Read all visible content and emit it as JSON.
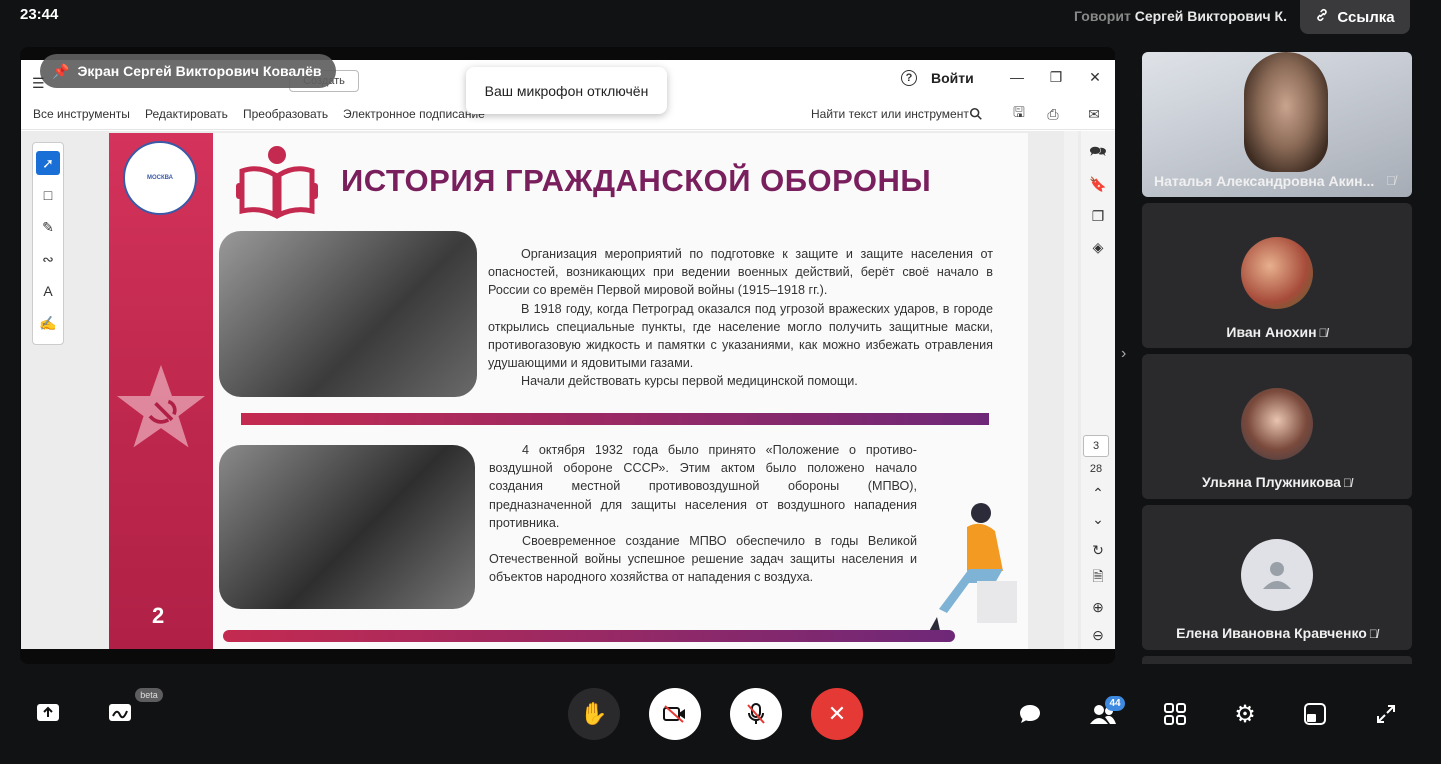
{
  "topbar": {
    "clock": "23:44",
    "speaker_prefix": "Говорит",
    "speaker_name": "Сергей Викторович К.",
    "link_label": "Ссылка"
  },
  "screen": {
    "label": "Экран Сергей Викторович Ковалёв",
    "toast": "Ваш микрофон отключён",
    "app": {
      "create_button": "Создать",
      "login": "Войти",
      "menu": [
        "Все инструменты",
        "Редактировать",
        "Преобразовать",
        "Электронное подписание"
      ],
      "find_placeholder": "Найти текст или инструмент",
      "page_current": "3",
      "page_total": "28"
    },
    "slide": {
      "title": "ИСТОРИЯ ГРАЖДАНСКОЙ ОБОРОНЫ",
      "logo_text": "МОСКВА",
      "para1": [
        "Организация мероприятий по подготовке к защите и защите населения от опасностей, возникающих при ведении военных действий, берёт своё начало в России со времён Первой мировой войны (1915–1918 гг.).",
        "В 1918 году, когда Петроград оказался под угрозой вражеских ударов, в городе открылись специальные пункты, где население могло получить защитные маски, противогазовую жидкость и памятки с указаниями, как можно избежать отравления удушающими и ядовитыми газами.",
        "Начали действовать курсы первой медицинской помощи."
      ],
      "para2": [
        "4 октября 1932 года было принято «Положение о противо-воздушной обороне СССР». Этим актом было положено начало создания местной противовоздушной обороны (МПВО), предназначенной для защиты населения от воздушного нападения противника.",
        "Своевременное создание МПВО обеспечило в годы Великой Отечественной войны успешное решение задач защиты населения и объектов народного хозяйства от нападения с воздуха."
      ],
      "page_number": "2"
    }
  },
  "participants": [
    {
      "name": "Наталья Александровна Акин...",
      "muted": true
    },
    {
      "name": "Иван Анохин",
      "muted": true
    },
    {
      "name": "Ульяна Плужникова",
      "muted": true
    },
    {
      "name": "Елена Ивановна Кравченко",
      "muted": true
    }
  ],
  "controls": {
    "beta_label": "beta",
    "participants_count": "44"
  },
  "colors": {
    "end_call": "#e53935",
    "accent_badge": "#3d8ae0",
    "slide_brand": "#c42a50"
  }
}
